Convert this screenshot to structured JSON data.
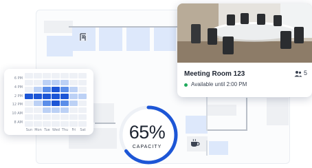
{
  "floor_plan": {
    "icons": [
      "office-building-icon",
      "coffee-cup-icon"
    ]
  },
  "heatmap": {
    "y_labels": [
      "6 PM",
      "4 PM",
      "2 PM",
      "12 PM",
      "10 AM",
      "8 AM"
    ],
    "x_labels": [
      "Sun",
      "Mon",
      "Tue",
      "Wed",
      "Thu",
      "Fri",
      "Sat"
    ],
    "levels": [
      [
        0,
        0,
        0,
        3,
        0,
        0,
        0
      ],
      [
        0,
        0,
        1,
        3,
        1,
        0,
        0
      ],
      [
        0,
        1,
        2,
        3,
        2,
        1,
        0
      ],
      [
        0,
        1,
        3,
        3,
        3,
        1,
        0
      ],
      [
        0,
        1,
        2,
        3,
        2,
        1,
        0
      ],
      [
        0,
        0,
        1,
        1,
        1,
        0,
        0
      ],
      [
        0,
        0,
        0,
        1,
        0,
        0,
        0
      ]
    ],
    "colors": [
      "#eef1f6",
      "#bcd1f5",
      "#5b8ee9",
      "#1d56d6"
    ]
  },
  "room_card": {
    "title": "Meeting Room 123",
    "availability": "Available until 2:00 PM",
    "capacity": "5",
    "status_color": "#1faa5c"
  },
  "gauge": {
    "value_text": "65%",
    "label": "CAPACITY",
    "fraction": 0.65,
    "color": "#1d56d6"
  }
}
